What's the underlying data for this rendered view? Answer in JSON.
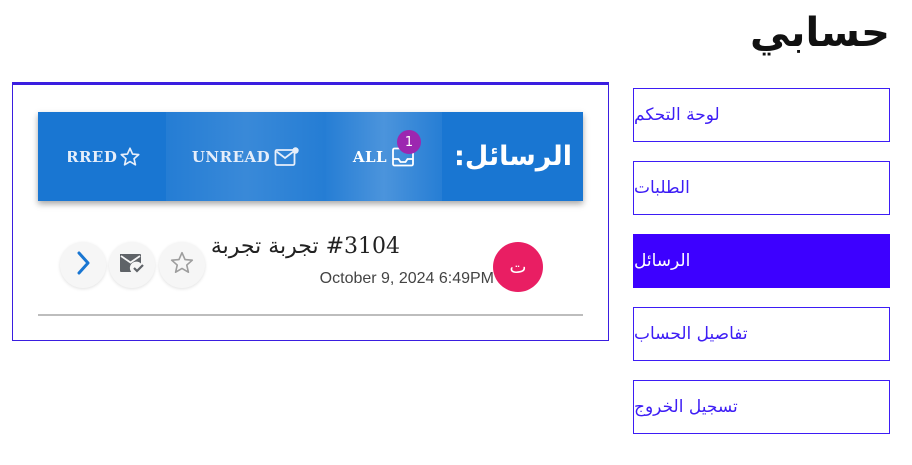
{
  "page": {
    "title": "حسابي"
  },
  "sidebar": {
    "items": [
      {
        "label": "لوحة التحكم",
        "active": false
      },
      {
        "label": "الطلبات",
        "active": false
      },
      {
        "label": "الرسائل",
        "active": true
      },
      {
        "label": "تفاصيل الحساب",
        "active": false
      },
      {
        "label": "تسجيل الخروج",
        "active": false
      }
    ]
  },
  "messages": {
    "title": "الرسائل:",
    "tabs": {
      "all": {
        "label": "ALL",
        "icon": "inbox-icon",
        "badge": "1",
        "selected": true
      },
      "unread": {
        "label": "UNREAD",
        "icon": "mail-unread-icon"
      },
      "starred": {
        "label": "RRED",
        "icon": "star-outline-icon"
      }
    },
    "list": [
      {
        "avatar_letter": "ت",
        "subject": "#3104 تجربة تجربة",
        "date": "October 9, 2024 6:49PM",
        "actions": [
          "star-outline-icon",
          "mark-read-icon",
          "chevron-right-icon"
        ]
      }
    ]
  },
  "colors": {
    "accent": "#3d00ff",
    "tabbar": "#1976d2",
    "badge": "#9c27b0",
    "avatar": "#e91e63"
  }
}
